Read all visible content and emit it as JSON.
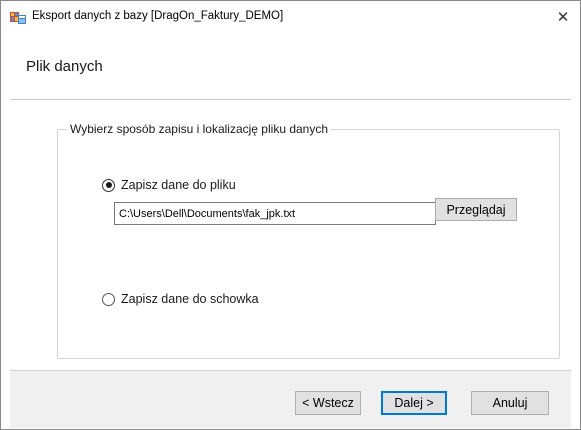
{
  "window": {
    "title": "Eksport danych z bazy [DragOn_Faktury_DEMO]",
    "close_glyph": "✕",
    "app_icon": "database-export-icon"
  },
  "header": {
    "title": "Plik danych"
  },
  "group": {
    "legend": "Wybierz sposób zapisu i lokalizację pliku danych"
  },
  "options": {
    "to_file": {
      "label": "Zapisz dane do pliku",
      "checked": true
    },
    "to_clipboard": {
      "label": "Zapisz dane do schowka",
      "checked": false
    }
  },
  "file_path": {
    "value": "C:\\Users\\Dell\\Documents\\fak_jpk.txt"
  },
  "buttons": {
    "browse": "Przeglądaj",
    "back": "< Wstecz",
    "next": "Dalej >",
    "cancel": "Anuluj"
  }
}
